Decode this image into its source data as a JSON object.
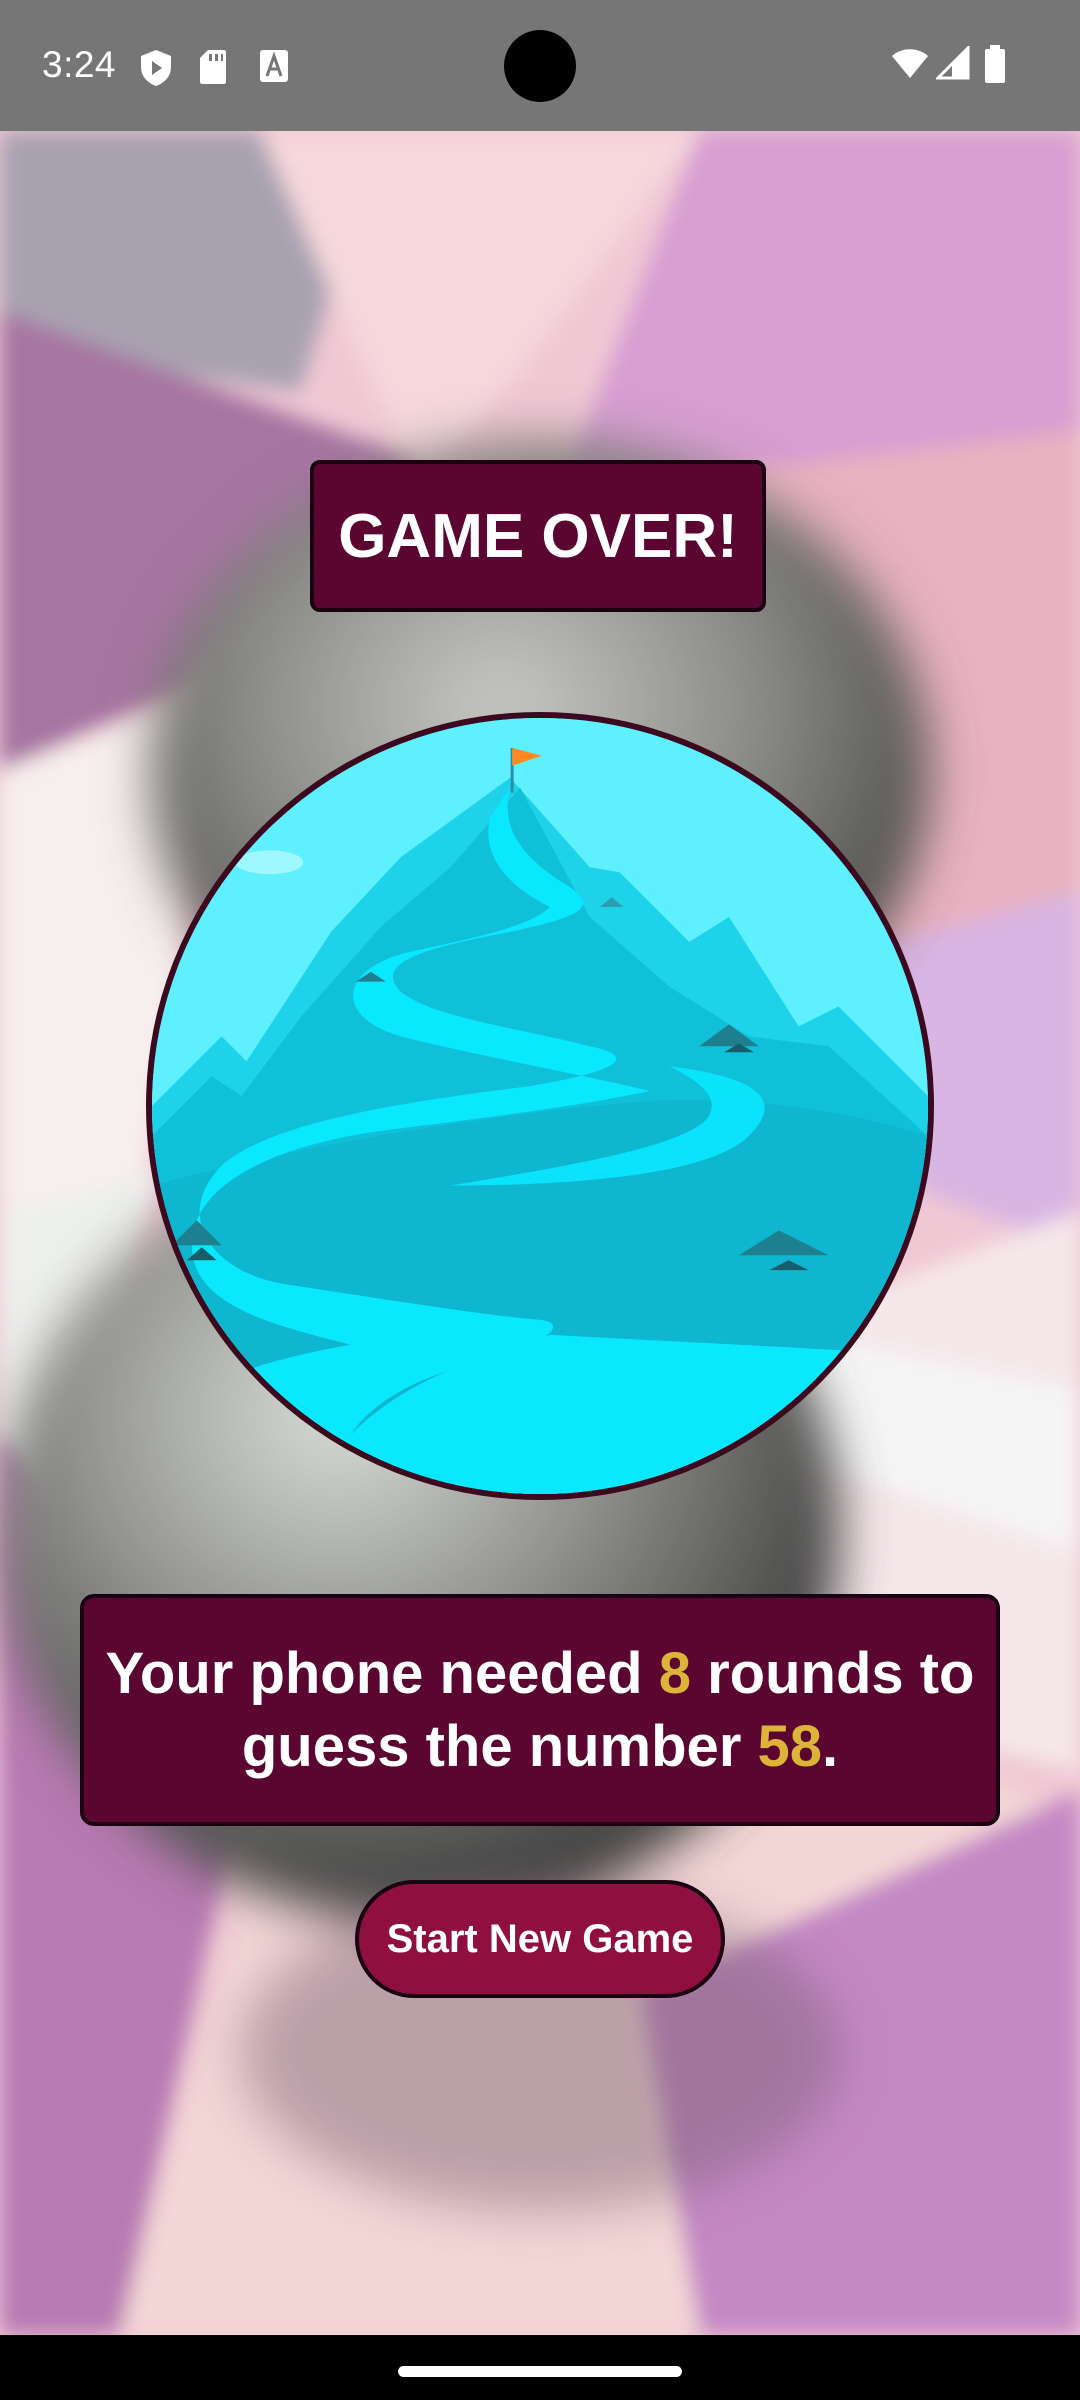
{
  "status_bar": {
    "time": "3:24",
    "left_icons": [
      "shield-icon",
      "sd-card-icon",
      "font-a-icon"
    ],
    "right_icons": [
      "wifi-icon",
      "signal-icon",
      "battery-icon"
    ]
  },
  "game_over": {
    "title": "GAME OVER!",
    "image": "mountain-summit-illustration",
    "summary": {
      "prefix": "Your phone needed ",
      "rounds": "8",
      "middle": " rounds to guess the number ",
      "number": "58",
      "suffix": "."
    },
    "button_label": "Start New Game"
  },
  "colors": {
    "panel": "#5b0630",
    "button": "#8f0f3f",
    "highlight": "#ddb43a",
    "status_bar": "#767676"
  }
}
